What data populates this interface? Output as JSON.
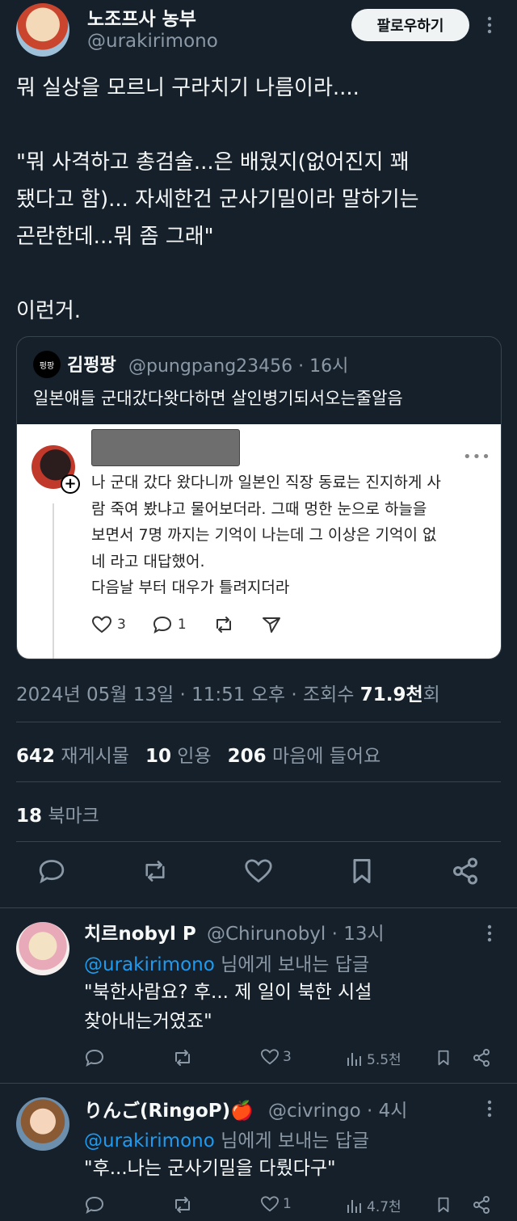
{
  "tweet": {
    "author_name": "노조프사 농부",
    "author_handle": "@urakirimono",
    "follow_label": "팔로우하기",
    "text": "뭐 실상을 모르니 구라치기 나름이라....\n\n\"뭐 사격하고 총검술...은 배웠지(없어진지 꽤\n됐다고 함)... 자세한건 군사기밀이라 말하기는\n곤란한데...뭐 좀 그래\"\n\n이런거.",
    "timestamp": "2024년 05월 13일 · 11:51 오후 · 조회수 ",
    "views": "71.9천",
    "views_suffix": "회"
  },
  "quote": {
    "avatar_text": "펑팡",
    "author_name": "김펑팡",
    "meta": "@pungpang23456 · 16시",
    "text": "일본얘들 군대갔다왓다하면 살인병기되서오는줄알음",
    "image_post": {
      "more": "•••",
      "lines": [
        "나 군대 갔다 왔다니까 일본인 직장 동료는 진지하게 사",
        "람 죽여 봤냐고 물어보더라. 그때 멍한 눈으로 하늘을",
        "보면서 7명 까지는 기억이 나는데 그 이상은 기억이 없",
        "네 라고 대답했어.",
        "다음날 부터 대우가 틀려지더라"
      ],
      "likes": "3",
      "replies": "1"
    }
  },
  "stats": {
    "retweets_count": "642",
    "retweets_label": "재게시물",
    "quotes_count": "10",
    "quotes_label": "인용",
    "likes_count": "206",
    "likes_label": "마음에 들어요",
    "bookmarks_count": "18",
    "bookmarks_label": "북마크"
  },
  "replies": [
    {
      "name": "치르nobyl P",
      "meta": "@Chirunobyl · 13시",
      "to_handle": "@urakirimono",
      "to_suffix": " 님에게 보내는 답글",
      "text": "\"북한사람요? 후... 제 일이 북한 시설\n찾아내는거였죠\"",
      "likes": "3",
      "views": "5.5천"
    },
    {
      "name": "りんご(RingoP)🍎",
      "meta": "@civringo · 4시",
      "to_handle": "@urakirimono",
      "to_suffix": " 님에게 보내는 답글",
      "text": "\"후...나는 군사기밀을 다뤘다구\"",
      "likes": "1",
      "views": "4.7천"
    }
  ]
}
